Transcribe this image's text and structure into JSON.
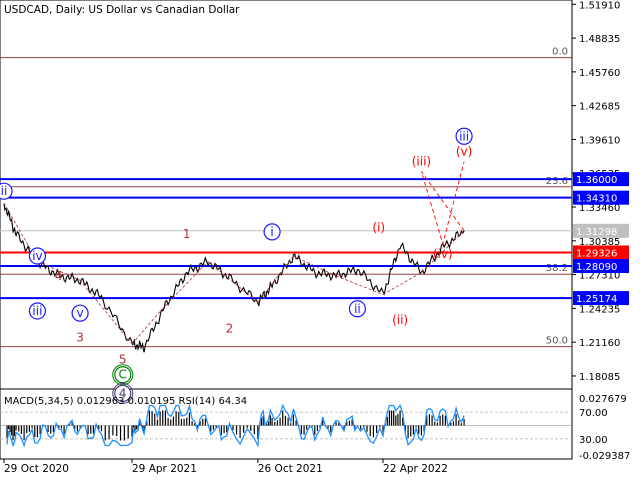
{
  "header": {
    "title": "USDCAD, Daily:  US Dollar vs Canadian Dollar"
  },
  "indicator_header": "MACD(5,34,5) 0.012963 0.010195 RSI(14) 64.34",
  "chart_data": [
    {
      "type": "line",
      "name": "USDCAD Daily price",
      "x_ticks": [
        "29 Oct 2020",
        "29 Apr 2021",
        "26 Oct 2021",
        "22 Apr 2022"
      ],
      "price_axis_ticks": [
        "1.51910",
        "1.48835",
        "1.45760",
        "1.42685",
        "1.39610",
        "1.36535",
        "1.33460",
        "1.30385",
        "1.27310",
        "1.24235",
        "1.21160",
        "1.18085"
      ],
      "ylim": [
        1.169,
        1.523
      ],
      "price_path": [
        [
          "29 Oct 2020",
          1.338
        ],
        [
          "Nov 2020",
          1.31
        ],
        [
          "Dec 2020",
          1.285
        ],
        [
          "Jan 2021",
          1.272
        ],
        [
          "Feb 2021",
          1.268
        ],
        [
          "Mar 2021",
          1.252
        ],
        [
          "29 Apr 2021",
          1.21
        ],
        [
          "May 2021",
          1.207
        ],
        [
          "Jun 2021",
          1.245
        ],
        [
          "Jul 2021",
          1.275
        ],
        [
          "Aug 2021",
          1.285
        ],
        [
          "Sep 2021",
          1.27
        ],
        [
          "26 Oct 2021",
          1.248
        ],
        [
          "Nov 2021",
          1.263
        ],
        [
          "Dec 2021",
          1.29
        ],
        [
          "Jan 2022",
          1.275
        ],
        [
          "Feb 2022",
          1.272
        ],
        [
          "Mar 2022",
          1.278
        ],
        [
          "22 Apr 2022",
          1.255
        ],
        [
          "May 2022",
          1.3
        ],
        [
          "Jun 2022",
          1.275
        ],
        [
          "Jul 2022",
          1.298
        ],
        [
          "Aug 2022",
          1.313
        ]
      ],
      "price_labels": [
        {
          "value": 1.36,
          "text": "1.36000",
          "color": "#0000ff"
        },
        {
          "value": 1.3431,
          "text": "1.34310",
          "color": "#0000ff"
        },
        {
          "value": 1.31298,
          "text": "1.31298",
          "color": "#c0c0c0"
        },
        {
          "value": 1.29326,
          "text": "1.29326",
          "color": "#ff0000"
        },
        {
          "value": 1.2809,
          "text": "1.28090",
          "color": "#0000ff"
        },
        {
          "value": 1.25174,
          "text": "1.25174",
          "color": "#0000ff"
        }
      ],
      "fibonacci_levels": [
        {
          "label": "0.0",
          "value": 1.4705
        },
        {
          "label": "23.6",
          "value": 1.353
        },
        {
          "label": "38.2",
          "value": 1.2735
        },
        {
          "label": "50.0",
          "value": 1.2075
        }
      ],
      "wave_labels": [
        {
          "text": "ii",
          "style": "circle",
          "color": "#1a1aff",
          "date": "29 Oct 2020",
          "price": 1.349
        },
        {
          "text": "iv",
          "style": "circle",
          "color": "#1a1aff",
          "date": "Dec 2020",
          "price": 1.29
        },
        {
          "text": "4",
          "style": "plain",
          "color": "#b03030",
          "date": "Jan 2021",
          "price": 1.272
        },
        {
          "text": "iii",
          "style": "circle",
          "color": "#1a1aff",
          "date": "Dec 2020",
          "price": 1.24
        },
        {
          "text": "v",
          "style": "circle",
          "color": "#1a1aff",
          "date": "Feb 2021",
          "price": 1.238
        },
        {
          "text": "3",
          "style": "plain",
          "color": "#b03030",
          "date": "Feb 2021",
          "price": 1.216
        },
        {
          "text": "5",
          "style": "plain",
          "color": "#b03030",
          "date": "Apr 2021",
          "price": 1.196
        },
        {
          "text": "C",
          "style": "double-circle",
          "color": "#008000",
          "date": "Apr 2021",
          "price": 1.182
        },
        {
          "text": "4",
          "style": "double-circle",
          "color": "#4b3a7a",
          "date": "Apr 2021",
          "price": 1.165
        },
        {
          "text": "1",
          "style": "plain",
          "color": "#b03030",
          "date": "Jul 2021",
          "price": 1.31
        },
        {
          "text": "2",
          "style": "plain",
          "color": "#b03030",
          "date": "Sep 2021",
          "price": 1.224
        },
        {
          "text": "i",
          "style": "circle",
          "color": "#1a1aff",
          "date": "Nov 2021",
          "price": 1.312
        },
        {
          "text": "ii",
          "style": "circle",
          "color": "#1a1aff",
          "date": "Mar 2022",
          "price": 1.242
        },
        {
          "text": "(i)",
          "style": "plain",
          "color": "#ff0000",
          "date": "Apr 2022",
          "price": 1.316
        },
        {
          "text": "(ii)",
          "style": "plain",
          "color": "#ff0000",
          "date": "May 2022",
          "price": 1.232
        },
        {
          "text": "(iii)",
          "style": "plain",
          "color": "#ff0000",
          "date": "Jun 2022",
          "price": 1.376
        },
        {
          "text": "(iv)",
          "style": "plain",
          "color": "#ff0000",
          "date": "Jul 2022",
          "price": 1.292
        },
        {
          "text": "(v)",
          "style": "plain",
          "color": "#ff0000",
          "date": "Aug 2022",
          "price": 1.385
        },
        {
          "text": "iii",
          "style": "circle",
          "color": "#1a1aff",
          "date": "Aug 2022",
          "price": 1.399
        }
      ]
    },
    {
      "type": "line",
      "name": "MACD(5,34,5) / RSI(14)",
      "macd_value": "0.012963",
      "macd_signal": "0.010195",
      "rsi_value": "64.34",
      "axis_ticks": [
        "0.027679",
        "70.00",
        "30.00",
        "-0.029387"
      ],
      "rsi_levels": [
        70.0,
        30.0
      ]
    }
  ]
}
